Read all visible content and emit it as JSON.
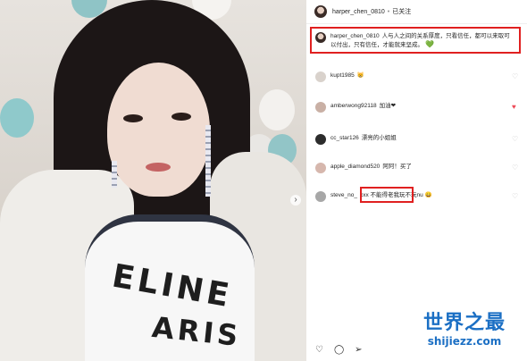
{
  "post": {
    "username": "harper_chen_0810",
    "dot": "•",
    "follow_status": "已关注"
  },
  "caption": {
    "username": "harper_chen_0810",
    "text": "人与人之间的关系厚度，只看信任，都可以来取可以付出，只有信任，才能就来坚成。",
    "emoji": "💚"
  },
  "comments": [
    {
      "username": "kupt1985",
      "text": "😸",
      "avatar": "#b9a08c",
      "liked": false
    },
    {
      "username": "amberwong92118",
      "text": "加油❤",
      "avatar": "#c9b0a5",
      "liked": true
    },
    {
      "username": "cc_star126",
      "text": "漂亮的小姐姐",
      "avatar": "#2c2c2c",
      "liked": false
    },
    {
      "username": "apple_diamond520",
      "text": "阿阿！买了",
      "avatar": "#d6b7ad",
      "liked": false
    },
    {
      "username": "steve_no_",
      "text": "xxx 不能得老我玩不玩nu 😄",
      "avatar": "#a7a7a7",
      "liked": false
    }
  ],
  "photo": {
    "shirt_line1": "ELINE",
    "shirt_line2": "ARIS"
  },
  "footer_icons": [
    "heart-outline-icon",
    "comment-icon",
    "share-icon"
  ],
  "watermark": {
    "title": "世界之最",
    "url": "shijiezz.com"
  },
  "colors": {
    "highlight_border": "#e02020",
    "like_red": "#ed4956",
    "watermark_blue": "#1b6fc4"
  }
}
